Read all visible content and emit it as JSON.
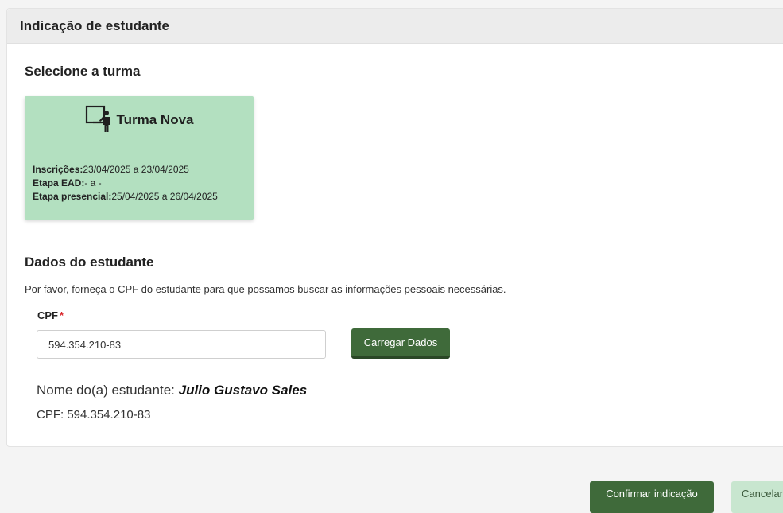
{
  "header": {
    "title": "Indicação de estudante"
  },
  "turma": {
    "section_title": "Selecione a turma",
    "card": {
      "icon": "teacher-board-icon",
      "title": "Turma Nova",
      "inscricoes_label": "Inscrições:",
      "inscricoes_value": "23/04/2025 a 23/04/2025",
      "ead_label": "Etapa EAD:",
      "ead_value": "- a -",
      "presencial_label": "Etapa presencial:",
      "presencial_value": "25/04/2025 a 26/04/2025",
      "background_color": "#b3e0c0"
    }
  },
  "student": {
    "section_title": "Dados do estudante",
    "description": "Por favor, forneça o CPF do estudante para que possamos buscar as informações pessoais necessárias.",
    "cpf_label": "CPF",
    "cpf_required_marker": "*",
    "cpf_value": "594.354.210-83",
    "load_button": "Carregar Dados",
    "result": {
      "name_label": "Nome do(a) estudante: ",
      "name_value": "Julio Gustavo Sales",
      "cpf_line": "CPF: 594.354.210-83"
    }
  },
  "actions": {
    "confirm": "Confirmar indicação",
    "cancel": "Cancelar"
  },
  "colors": {
    "primary_green": "#3f6a3a",
    "light_green": "#c8e6cf",
    "required_red": "#d9252a"
  }
}
